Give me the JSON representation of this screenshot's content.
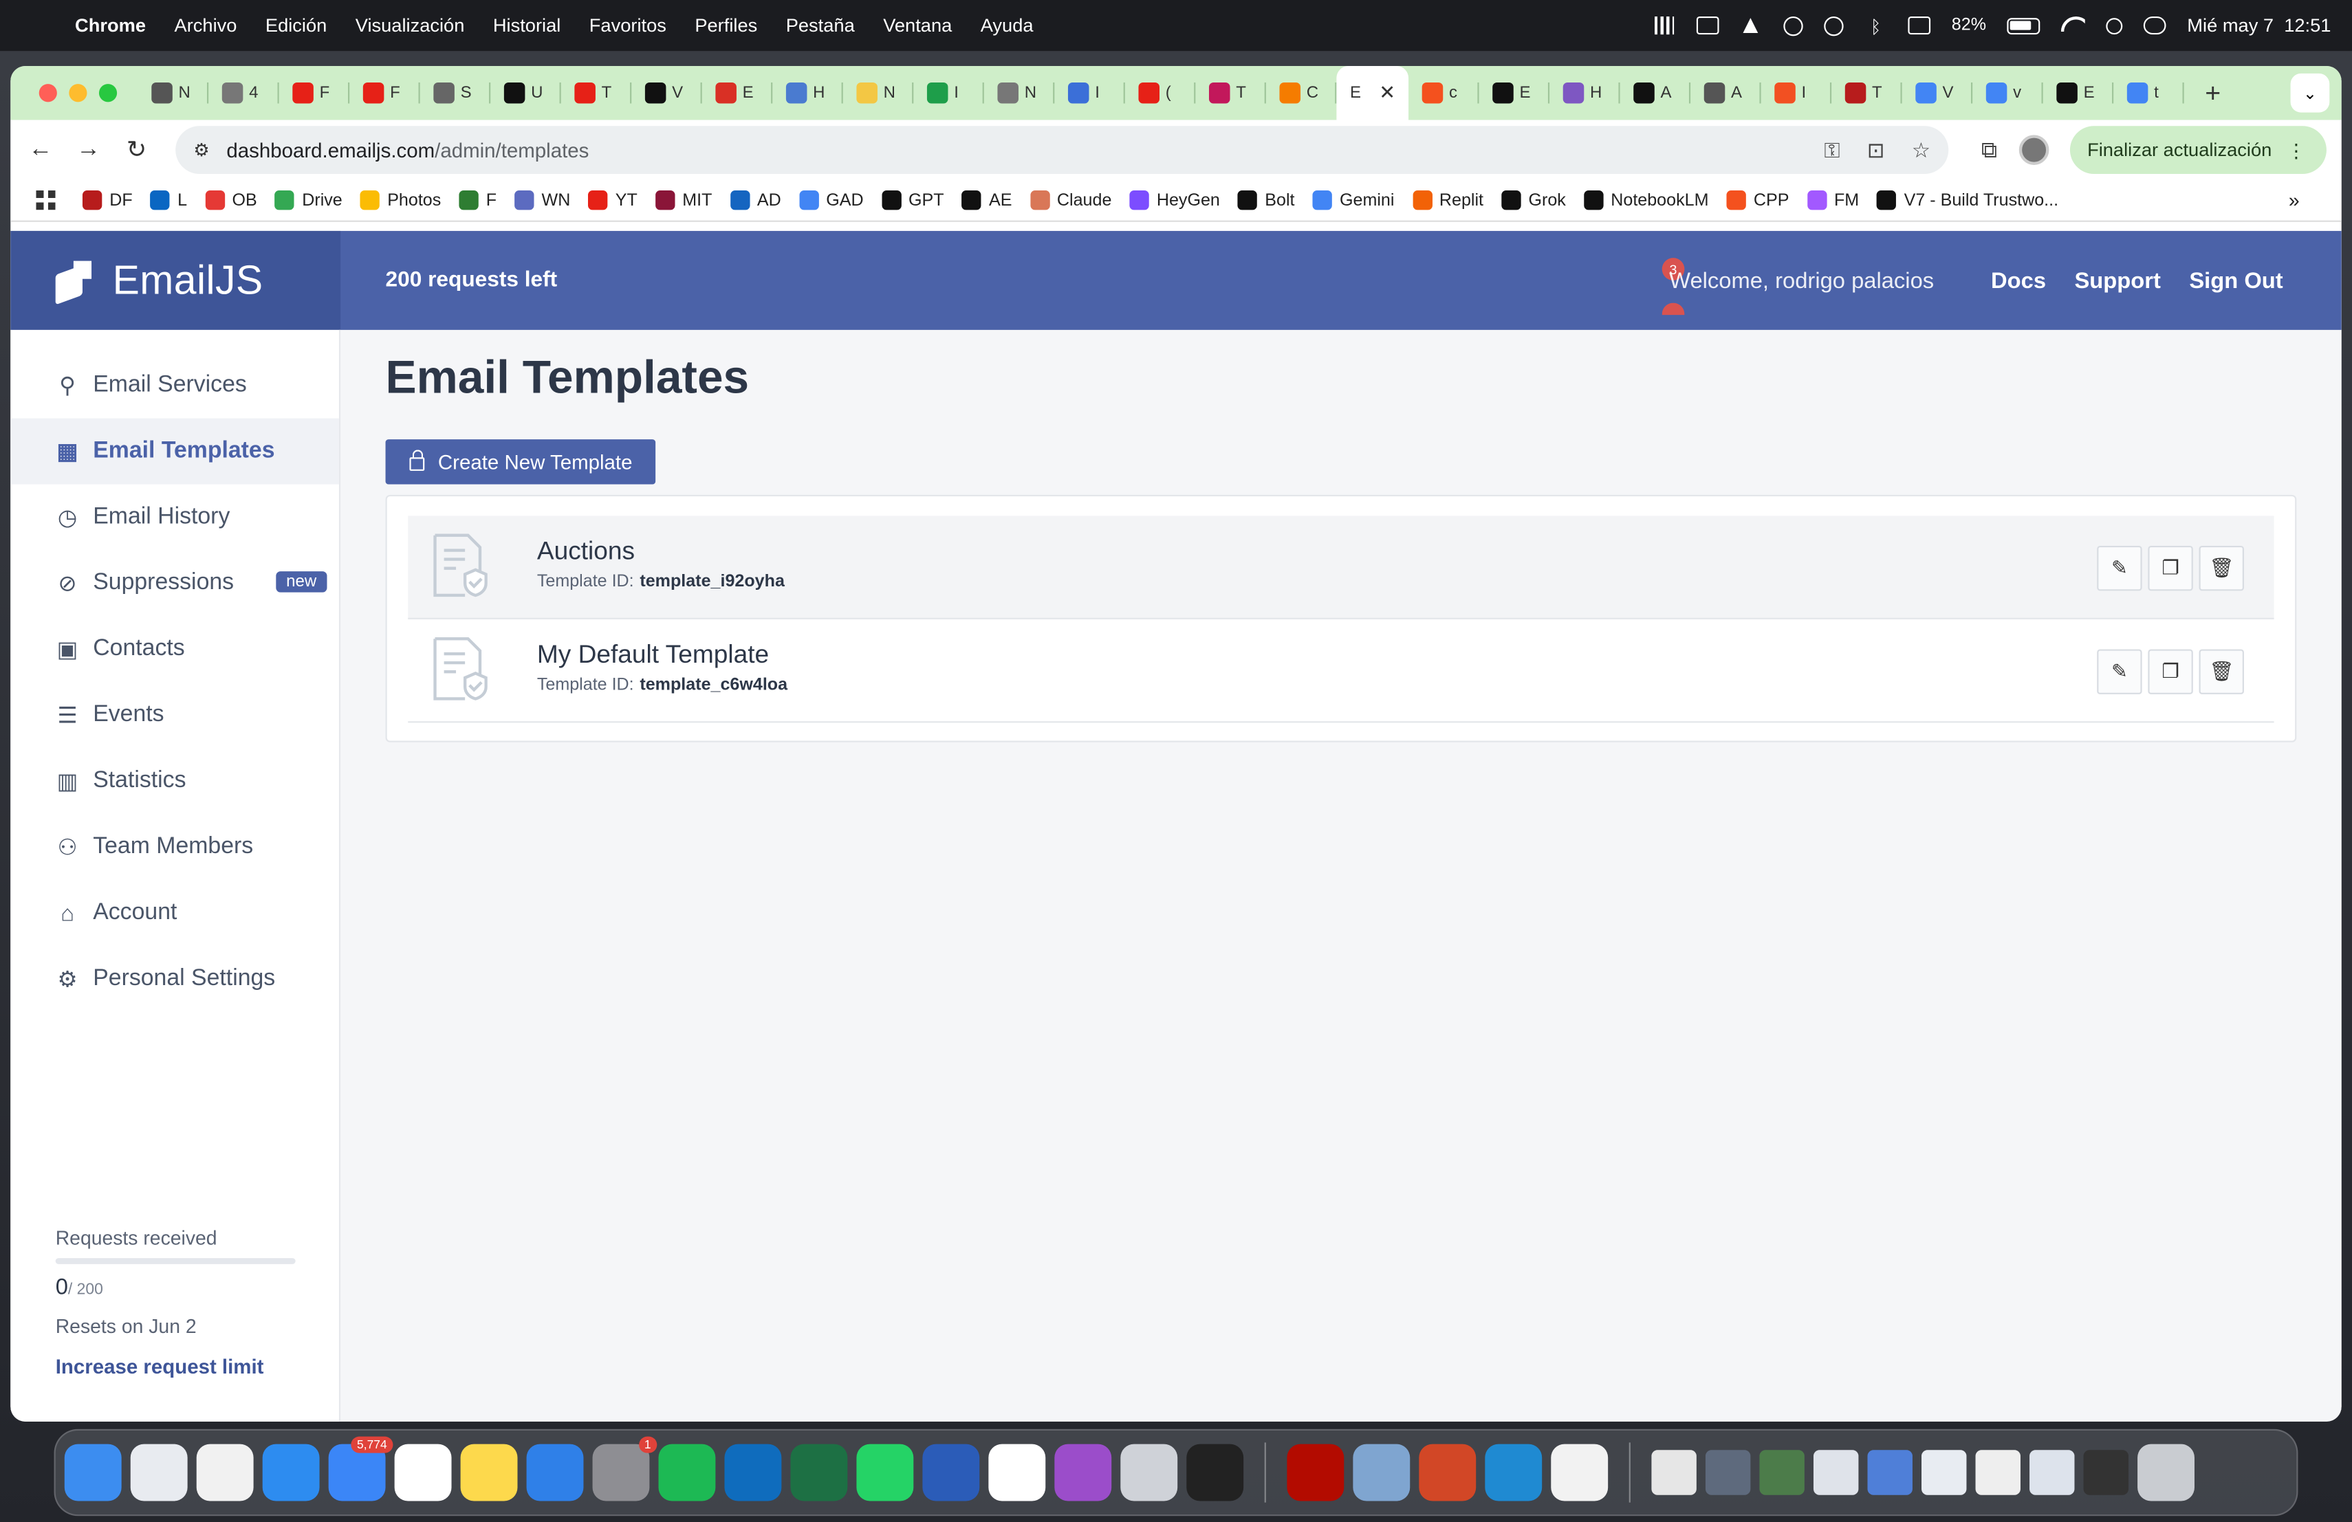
{
  "menubar": {
    "app_name": "Chrome",
    "items": [
      "Archivo",
      "Edición",
      "Visualización",
      "Historial",
      "Favoritos",
      "Perfiles",
      "Pestaña",
      "Ventana",
      "Ayuda"
    ],
    "battery": "82%",
    "clock": "Mié may 7  12:51"
  },
  "browser": {
    "tabs": [
      {
        "label": "N",
        "color": "#555555"
      },
      {
        "label": "4",
        "color": "#777777"
      },
      {
        "label": "F",
        "color": "#e62117"
      },
      {
        "label": "F",
        "color": "#e62117"
      },
      {
        "label": "S",
        "color": "#666666"
      },
      {
        "label": "U",
        "color": "#111111"
      },
      {
        "label": "T",
        "color": "#e62117"
      },
      {
        "label": "V",
        "color": "#111111"
      },
      {
        "label": "E",
        "color": "#d93025"
      },
      {
        "label": "H",
        "color": "#4a7bd0"
      },
      {
        "label": "N",
        "color": "#f3c744"
      },
      {
        "label": "I",
        "color": "#1e9e4a"
      },
      {
        "label": "N",
        "color": "#777777"
      },
      {
        "label": "I",
        "color": "#3b6fd8"
      },
      {
        "label": "(",
        "color": "#e62117"
      },
      {
        "label": "T",
        "color": "#c2185b"
      },
      {
        "label": "C",
        "color": "#f57c00"
      },
      {
        "label": "E",
        "color": "#ffffff",
        "active": true
      },
      {
        "label": "c",
        "color": "#f4511e"
      },
      {
        "label": "E",
        "color": "#111111"
      },
      {
        "label": "H",
        "color": "#7e57c2"
      },
      {
        "label": "A",
        "color": "#111111"
      },
      {
        "label": "A",
        "color": "#555555"
      },
      {
        "label": "I",
        "color": "#f25022"
      },
      {
        "label": "T",
        "color": "#b71c1c"
      },
      {
        "label": "V",
        "color": "#4285f4"
      },
      {
        "label": "v",
        "color": "#4285f4"
      },
      {
        "label": "E",
        "color": "#111111"
      },
      {
        "label": "t",
        "color": "#4285f4"
      }
    ],
    "url_host": "dashboard.emailjs.com",
    "url_path": "/admin/templates",
    "update_button": "Finalizar actualización",
    "bookmarks": [
      {
        "label": "DF",
        "color": "#b71c1c"
      },
      {
        "label": "L",
        "color": "#0a66c2"
      },
      {
        "label": "OB",
        "color": "#e53935"
      },
      {
        "label": "Drive",
        "color": "#34a853"
      },
      {
        "label": "Photos",
        "color": "#fbbc04"
      },
      {
        "label": "F",
        "color": "#2e7d32"
      },
      {
        "label": "WN",
        "color": "#5c6bc0"
      },
      {
        "label": "YT",
        "color": "#e62117"
      },
      {
        "label": "MIT",
        "color": "#8a1538"
      },
      {
        "label": "AD",
        "color": "#1565c0"
      },
      {
        "label": "GAD",
        "color": "#4285f4"
      },
      {
        "label": "GPT",
        "color": "#111111"
      },
      {
        "label": "AE",
        "color": "#111111"
      },
      {
        "label": "Claude",
        "color": "#d97757"
      },
      {
        "label": "HeyGen",
        "color": "#7c4dff"
      },
      {
        "label": "Bolt",
        "color": "#111111"
      },
      {
        "label": "Gemini",
        "color": "#4285f4"
      },
      {
        "label": "Replit",
        "color": "#f26207"
      },
      {
        "label": "Grok",
        "color": "#111111"
      },
      {
        "label": "NotebookLM",
        "color": "#111111"
      },
      {
        "label": "CPP",
        "color": "#f4511e"
      },
      {
        "label": "FM",
        "color": "#a259ff"
      },
      {
        "label": "V7 - Build Trustwo...",
        "color": "#111111"
      }
    ]
  },
  "app": {
    "logo": "EmailJS",
    "requests_left": "200 requests left",
    "notification_count": "3",
    "welcome": "Welcome,",
    "user_name": "rodrigo palacios",
    "header_links": [
      "Docs",
      "Support",
      "Sign Out"
    ],
    "nav": [
      {
        "label": "Email Services",
        "icon": "plug-icon",
        "glyph": "⚲"
      },
      {
        "label": "Email Templates",
        "icon": "templates-icon",
        "glyph": "▦",
        "active": true
      },
      {
        "label": "Email History",
        "icon": "history-icon",
        "glyph": "◷"
      },
      {
        "label": "Suppressions",
        "icon": "ban-icon",
        "glyph": "⊘",
        "badge": "new"
      },
      {
        "label": "Contacts",
        "icon": "contacts-icon",
        "glyph": "▣"
      },
      {
        "label": "Events",
        "icon": "list-icon",
        "glyph": "☰"
      },
      {
        "label": "Statistics",
        "icon": "chart-icon",
        "glyph": "▥"
      },
      {
        "label": "Team Members",
        "icon": "team-icon",
        "glyph": "⚇"
      },
      {
        "label": "Account",
        "icon": "bank-icon",
        "glyph": "⌂"
      },
      {
        "label": "Personal Settings",
        "icon": "gear-icon",
        "glyph": "⚙"
      }
    ],
    "usage": {
      "label": "Requests received",
      "used": "0",
      "limit": "/ 200",
      "fraction_used": 0,
      "resets": "Resets on Jun 2",
      "increase": "Increase request limit"
    },
    "page_title": "Email Templates",
    "create_button": "Create New Template",
    "templates": [
      {
        "name": "Auctions",
        "id_label": "Template ID:",
        "id": "template_i92oyha"
      },
      {
        "name": "My Default Template",
        "id_label": "Template ID:",
        "id": "template_c6w4loa"
      }
    ]
  },
  "dock": {
    "apps": [
      {
        "name": "Finder",
        "color": "#3c8df0"
      },
      {
        "name": "Launchpad",
        "color": "#e8ebf0"
      },
      {
        "name": "Chrome",
        "color": "#f1f1f1"
      },
      {
        "name": "Safari",
        "color": "#2d8cf0"
      },
      {
        "name": "Mail",
        "color": "#3b86f7",
        "badge": "5,774"
      },
      {
        "name": "Calendar",
        "color": "#ffffff"
      },
      {
        "name": "Notes",
        "color": "#fdd94c"
      },
      {
        "name": "Keynote",
        "color": "#2f80e8"
      },
      {
        "name": "System Settings",
        "color": "#8e8e93",
        "badge": "1"
      },
      {
        "name": "Spotify",
        "color": "#1db954"
      },
      {
        "name": "Outlook",
        "color": "#0f6cbd"
      },
      {
        "name": "Excel",
        "color": "#1d7044"
      },
      {
        "name": "WhatsApp",
        "color": "#25d366"
      },
      {
        "name": "Word",
        "color": "#2b5cb8"
      },
      {
        "name": "Calendar Widget",
        "color": "#ffffff"
      },
      {
        "name": "Circle",
        "color": "#9b4dca"
      },
      {
        "name": "iPhone Mirroring",
        "color": "#cfd2d8"
      },
      {
        "name": "Dark App",
        "color": "#222222"
      },
      {
        "name": "Acrobat",
        "color": "#b30b00"
      },
      {
        "name": "Preview",
        "color": "#7fa5d0"
      },
      {
        "name": "PowerPoint",
        "color": "#d24726"
      },
      {
        "name": "VS Code",
        "color": "#1f8ad2"
      },
      {
        "name": "TextEdit",
        "color": "#f2f2f2"
      },
      {
        "name": "Document",
        "color": "#e6e6e6"
      },
      {
        "name": "File",
        "color": "#5e6a7d"
      },
      {
        "name": "File",
        "color": "#4c7c4a"
      },
      {
        "name": "Screenshot",
        "color": "#dfe3ea"
      },
      {
        "name": "File",
        "color": "#4f7fd8"
      },
      {
        "name": "Screenshot",
        "color": "#e8ecf2"
      },
      {
        "name": "Screenshot",
        "color": "#eeeeee"
      },
      {
        "name": "Screenshot",
        "color": "#dde3ec"
      },
      {
        "name": "Screenshot",
        "color": "#333333"
      },
      {
        "name": "Trash",
        "color": "#c9ccd1"
      }
    ]
  }
}
